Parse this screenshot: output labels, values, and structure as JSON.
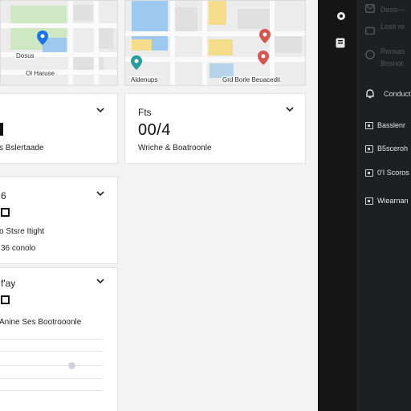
{
  "maps": {
    "left": {
      "labels": [
        "Dosus",
        "Ol Haruse"
      ]
    },
    "right": {
      "labels": [
        "Aldenups",
        "Grd Borle Beuacedit"
      ]
    }
  },
  "cards": [
    {
      "title": "",
      "value": "",
      "desc": "s Bslertaade"
    },
    {
      "title": "Fts",
      "value": "00/4",
      "desc": "Wriche & Boatroonle"
    },
    {
      "title": "6",
      "desc1": "o Stsre Itight",
      "desc2": "36 conolo"
    },
    {
      "title": "f'ay",
      "desc": "Anine Ses Bootrooonle"
    }
  ],
  "sidebar": {
    "top_texts": [
      "Dess—",
      "Lose re",
      "Ronsas",
      "Bosnot"
    ],
    "section": "Conduct",
    "items": [
      "Basslenr",
      "B5sceroh",
      "0'I Scoros",
      "Wiearnan"
    ]
  },
  "colors": {
    "map_green": "#cfe7c3",
    "map_blue": "#9dc8ef",
    "map_yellow": "#f3dd8b",
    "pin_red": "#d9534f",
    "pin_blue": "#1a73e8",
    "pin_teal": "#2a9d9d"
  }
}
